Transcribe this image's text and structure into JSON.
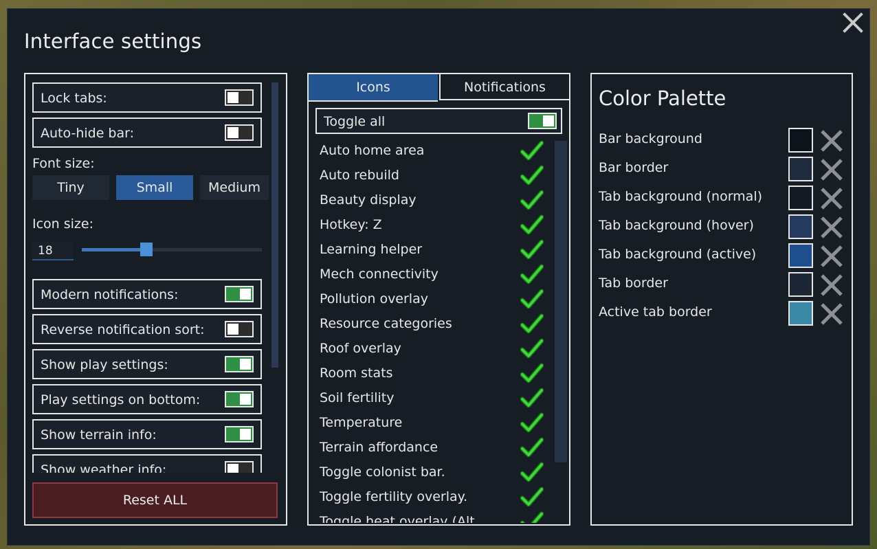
{
  "dialog": {
    "title": "Interface settings",
    "close_icon": "close-icon"
  },
  "left": {
    "toggles_top": [
      {
        "label": "Lock tabs:",
        "on": false
      },
      {
        "label": "Auto-hide bar:",
        "on": false
      }
    ],
    "font_size_label": "Font size:",
    "font_sizes": [
      "Tiny",
      "Small",
      "Medium"
    ],
    "font_size_selected": "Small",
    "icon_size_label": "Icon size:",
    "icon_size_value": "18",
    "icon_size_fraction": 0.36,
    "toggles_bottom": [
      {
        "label": "Modern notifications:",
        "on": true
      },
      {
        "label": "Reverse notification sort:",
        "on": false
      },
      {
        "label": "Show play settings:",
        "on": true
      },
      {
        "label": "Play settings on bottom:",
        "on": true
      },
      {
        "label": "Show terrain info:",
        "on": true
      },
      {
        "label": "Show weather info:",
        "on": false
      }
    ],
    "reset_label": "Reset ALL"
  },
  "middle": {
    "tabs": [
      "Icons",
      "Notifications"
    ],
    "active_tab": "Icons",
    "toggle_all_label": "Toggle all",
    "toggle_all_on": true,
    "items": [
      "Auto home area",
      "Auto rebuild",
      "Beauty display",
      "Hotkey: Z",
      "Learning helper",
      "Mech connectivity",
      "Pollution overlay",
      "Resource categories",
      "Roof overlay",
      "Room stats",
      "Soil fertility",
      "Temperature",
      "Terrain affordance",
      "Toggle colonist bar.",
      "Toggle fertility overlay.",
      "Toggle heat overlay (Alt..."
    ]
  },
  "palette": {
    "title": "Color Palette",
    "rows": [
      {
        "label": "Bar background",
        "color": "#0e141c"
      },
      {
        "label": "Bar border",
        "color": "#1f2b3c"
      },
      {
        "label": "Tab background (normal)",
        "color": "#131a24"
      },
      {
        "label": "Tab background (hover)",
        "color": "#243a5e"
      },
      {
        "label": "Tab background (active)",
        "color": "#1f4f8e"
      },
      {
        "label": "Tab border",
        "color": "#1d2635"
      },
      {
        "label": "Active tab border",
        "color": "#3a8aa6"
      }
    ]
  },
  "colors": {
    "toggle_on": "#2f8f45",
    "check_green": "#3fd63a",
    "accent_blue": "#2a5a9a",
    "reset_bg": "#4a1d22"
  }
}
